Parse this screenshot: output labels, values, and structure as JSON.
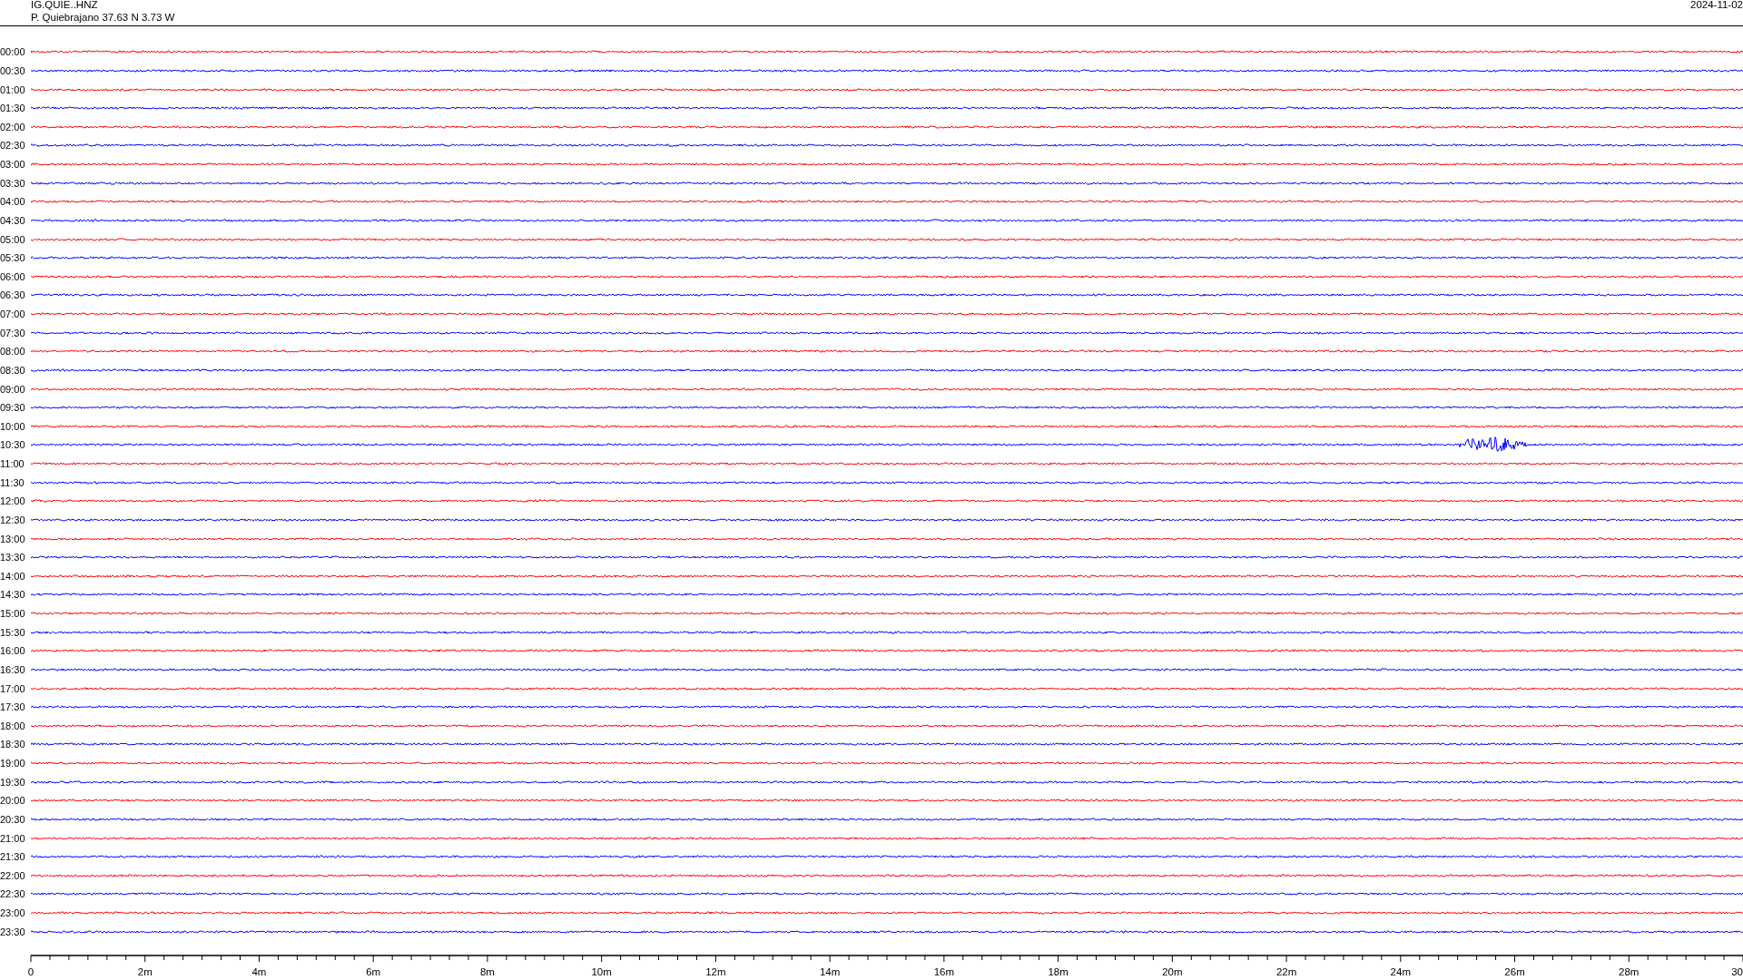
{
  "header": {
    "channel": "IG.QUIE..HNZ",
    "station": "P. Quiebrajano  37.63 N 3.73 W",
    "date": "2024-11-02"
  },
  "rows": [
    {
      "label": "00:00",
      "color": "#ff0000",
      "kind": "quiet"
    },
    {
      "label": "00:30",
      "color": "#0000ff",
      "kind": "quiet"
    },
    {
      "label": "01:00",
      "color": "#ff0000",
      "kind": "quiet"
    },
    {
      "label": "01:30",
      "color": "#0000ff",
      "kind": "quiet"
    },
    {
      "label": "02:00",
      "color": "#ff0000",
      "kind": "quiet"
    },
    {
      "label": "02:30",
      "color": "#0000ff",
      "kind": "quiet"
    },
    {
      "label": "03:00",
      "color": "#ff0000",
      "kind": "quiet"
    },
    {
      "label": "03:30",
      "color": "#0000ff",
      "kind": "quiet"
    },
    {
      "label": "04:00",
      "color": "#ff0000",
      "kind": "quiet"
    },
    {
      "label": "04:30",
      "color": "#0000ff",
      "kind": "quiet"
    },
    {
      "label": "05:00",
      "color": "#ff0000",
      "kind": "quiet"
    },
    {
      "label": "05:30",
      "color": "#0000ff",
      "kind": "quiet"
    },
    {
      "label": "06:00",
      "color": "#ff0000",
      "kind": "quiet"
    },
    {
      "label": "06:30",
      "color": "#0000ff",
      "kind": "quiet"
    },
    {
      "label": "07:00",
      "color": "#ff0000",
      "kind": "quiet"
    },
    {
      "label": "07:30",
      "color": "#0000ff",
      "kind": "quiet"
    },
    {
      "label": "08:00",
      "color": "#ff0000",
      "kind": "quiet"
    },
    {
      "label": "08:30",
      "color": "#0000ff",
      "kind": "quiet"
    },
    {
      "label": "09:00",
      "color": "#ff0000",
      "kind": "quiet"
    },
    {
      "label": "09:30",
      "color": "#0000ff",
      "kind": "quiet"
    },
    {
      "label": "10:00",
      "color": "#ff0000",
      "kind": "quiet"
    },
    {
      "label": "10:30",
      "color": "#0000ff",
      "kind": "event"
    },
    {
      "label": "11:00",
      "color": "#ff0000",
      "kind": "quiet"
    },
    {
      "label": "11:30",
      "color": "#0000ff",
      "kind": "quiet"
    },
    {
      "label": "12:00",
      "color": "#ff0000",
      "kind": "quiet"
    },
    {
      "label": "12:30",
      "color": "#0000ff",
      "kind": "quiet"
    },
    {
      "label": "13:00",
      "color": "#ff0000",
      "kind": "quiet"
    },
    {
      "label": "13:30",
      "color": "#0000ff",
      "kind": "quiet"
    },
    {
      "label": "14:00",
      "color": "#ff0000",
      "kind": "quiet"
    },
    {
      "label": "14:30",
      "color": "#0000ff",
      "kind": "quiet"
    },
    {
      "label": "15:00",
      "color": "#ff0000",
      "kind": "quiet"
    },
    {
      "label": "15:30",
      "color": "#0000ff",
      "kind": "quiet"
    },
    {
      "label": "16:00",
      "color": "#ff0000",
      "kind": "quiet"
    },
    {
      "label": "16:30",
      "color": "#0000ff",
      "kind": "quiet"
    },
    {
      "label": "17:00",
      "color": "#ff0000",
      "kind": "quiet"
    },
    {
      "label": "17:30",
      "color": "#0000ff",
      "kind": "quiet"
    },
    {
      "label": "18:00",
      "color": "#ff0000",
      "kind": "quiet"
    },
    {
      "label": "18:30",
      "color": "#0000ff",
      "kind": "quiet"
    },
    {
      "label": "19:00",
      "color": "#ff0000",
      "kind": "quiet"
    },
    {
      "label": "19:30",
      "color": "#0000ff",
      "kind": "quiet"
    },
    {
      "label": "20:00",
      "color": "#ff0000",
      "kind": "quiet"
    },
    {
      "label": "20:30",
      "color": "#0000ff",
      "kind": "quiet"
    },
    {
      "label": "21:00",
      "color": "#ff0000",
      "kind": "quiet"
    },
    {
      "label": "21:30",
      "color": "#0000ff",
      "kind": "quiet"
    },
    {
      "label": "22:00",
      "color": "#ff0000",
      "kind": "quiet"
    },
    {
      "label": "22:30",
      "color": "#0000ff",
      "kind": "quiet"
    },
    {
      "label": "23:00",
      "color": "#ff0000",
      "kind": "quiet"
    },
    {
      "label": "23:30",
      "color": "#0000ff",
      "kind": "quiet"
    }
  ],
  "axis_ticks": [
    "0",
    "2m",
    "4m",
    "6m",
    "8m",
    "10m",
    "12m",
    "14m",
    "16m",
    "18m",
    "20m",
    "22m",
    "24m",
    "26m",
    "28m",
    "30"
  ]
}
